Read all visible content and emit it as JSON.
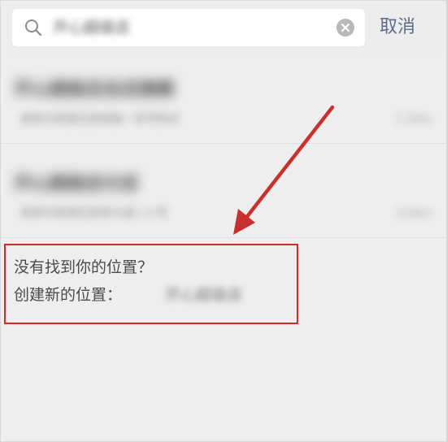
{
  "search": {
    "query": "开心超级店",
    "cancel_label": "取消"
  },
  "results": [
    {
      "title": "开心超级店总店旗舰",
      "subtitle": "某某市某某区某某路一百号附近",
      "distance": "1.2km"
    },
    {
      "title": "开心超级店分店",
      "subtitle": "某某市某某区某某大道二十号",
      "distance": "3.5km"
    }
  ],
  "create_location": {
    "not_found_text": "没有找到你的位置？",
    "create_label": "创建新的位置：",
    "location_name": "开心超级店"
  },
  "colors": {
    "accent_link": "#5b6b8c",
    "annotation_red": "#c9302c"
  },
  "icons": {
    "search": "search-icon",
    "clear": "clear-icon"
  }
}
